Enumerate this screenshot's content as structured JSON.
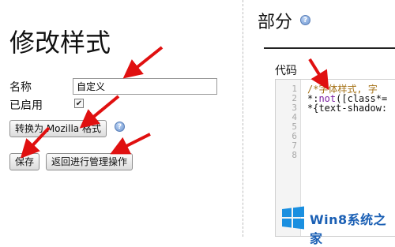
{
  "left": {
    "page_title": "修改样式",
    "name_label": "名称",
    "name_value": "自定义",
    "enabled_label": "已启用",
    "enabled_checked": true,
    "convert_button": "转换为 Mozilla 格式",
    "save_button": "保存",
    "back_button": "返回进行管理操作"
  },
  "right": {
    "section_title": "部分",
    "code_label": "代码",
    "line_numbers": [
      "1",
      "2",
      "3",
      "4",
      "5",
      "6",
      "7",
      "8"
    ],
    "code": {
      "line1": "/*字体样式, 字",
      "line2_prefix": "*:",
      "line2_keyword": "not",
      "line2_suffix": "([class*=",
      "line3": "*{text-shadow:"
    }
  },
  "watermark": {
    "text": "Win8系统之家"
  },
  "colors": {
    "arrow": "#e01010",
    "comment": "#a57217",
    "keyword": "#7b1fa2",
    "help_icon": "#6e95cf",
    "watermark": "#1a5fb4"
  },
  "icons": {
    "help": "help-icon",
    "arrow": "red-arrow-annotation",
    "windows_logo": "windows-logo-icon"
  }
}
